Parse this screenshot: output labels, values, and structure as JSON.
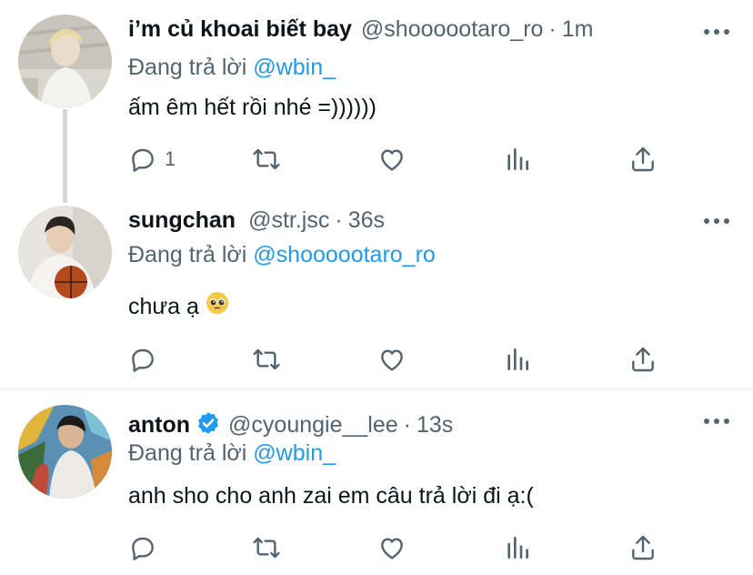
{
  "replies": [
    {
      "name": "i’m củ khoai biết bay",
      "handle": "@shoooootaro_ro",
      "dot": "·",
      "time": "1m",
      "replying_prefix": "Đang trả lời",
      "replying_to": "@wbin_",
      "text": "ấm êm hết rồi nhé =))))))",
      "reply_count": "1",
      "verified": false
    },
    {
      "name": "sungchan",
      "handle": "@str.jsc",
      "dot": "·",
      "time": "36s",
      "replying_prefix": "Đang trả lời",
      "replying_to": "@shoooootaro_ro",
      "text": "chưa ạ",
      "emoji": "pleading-face",
      "reply_count": "",
      "verified": false
    },
    {
      "name": "anton",
      "handle": "@cyoungie__lee",
      "dot": "·",
      "time": "13s",
      "replying_prefix": "Đang trả lời",
      "replying_to": "@wbin_",
      "text": "anh sho cho anh zai em câu trả lời đi ạ:(",
      "reply_count": "",
      "verified": true
    }
  ],
  "colors": {
    "text_primary": "#0f1419",
    "text_secondary": "#536471",
    "link": "#1d9bf0",
    "thread_line": "#cfd9de",
    "divider": "#eff3f4"
  },
  "icons": [
    "reply-icon",
    "retweet-icon",
    "like-icon",
    "analytics-icon",
    "share-icon",
    "more-icon",
    "verified-badge-icon"
  ]
}
